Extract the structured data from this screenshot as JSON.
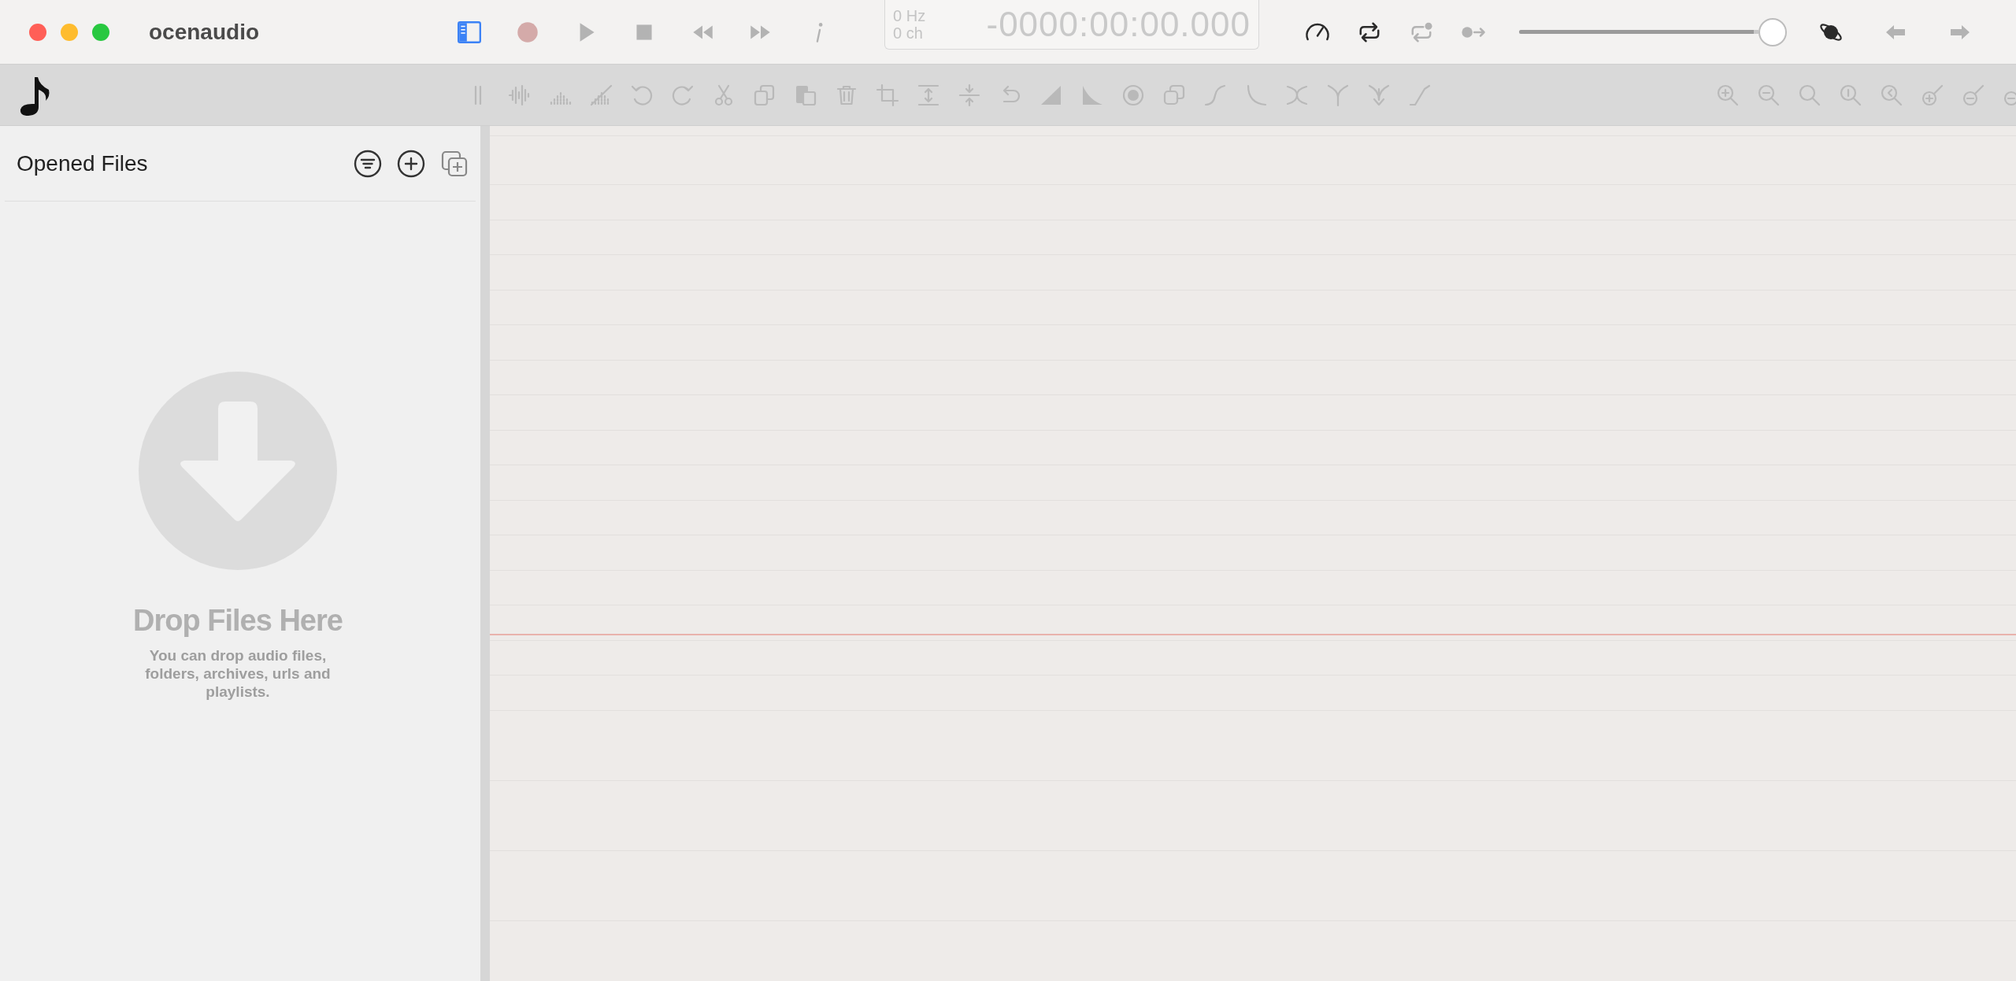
{
  "window": {
    "title": "ocenaudio"
  },
  "transport": [
    {
      "kind": "sidebar",
      "disabled": false
    },
    {
      "kind": "record",
      "disabled": true
    },
    {
      "kind": "play",
      "disabled": true
    },
    {
      "kind": "stop",
      "disabled": true
    },
    {
      "kind": "rewind",
      "disabled": true
    },
    {
      "kind": "forward",
      "disabled": true
    },
    {
      "kind": "info",
      "disabled": true
    }
  ],
  "display": {
    "rate": "0 Hz",
    "channels": "0 ch",
    "time": "-0000:00:00.000"
  },
  "playback_tools": [
    {
      "kind": "speed",
      "disabled": false
    },
    {
      "kind": "loop",
      "disabled": false
    },
    {
      "kind": "loop-selection",
      "disabled": true
    },
    {
      "kind": "follow",
      "disabled": true
    }
  ],
  "volume": {
    "level": 0.98
  },
  "nav_tools": [
    {
      "kind": "planet",
      "disabled": false
    },
    {
      "kind": "back",
      "disabled": true
    },
    {
      "kind": "next",
      "disabled": true
    }
  ],
  "edit_toolbar": [
    {
      "kind": "channels",
      "disabled": true
    },
    {
      "kind": "waveform",
      "disabled": true
    },
    {
      "kind": "spectrum",
      "disabled": true
    },
    {
      "kind": "spectrum-off",
      "disabled": true
    },
    {
      "kind": "undo",
      "disabled": true
    },
    {
      "kind": "redo",
      "disabled": true
    },
    {
      "kind": "cut",
      "disabled": true
    },
    {
      "kind": "copy",
      "disabled": true
    },
    {
      "kind": "paste",
      "disabled": true
    },
    {
      "kind": "delete",
      "disabled": true
    },
    {
      "kind": "crop",
      "disabled": true
    },
    {
      "kind": "expand",
      "disabled": true
    },
    {
      "kind": "contract",
      "disabled": true
    },
    {
      "kind": "reverse",
      "disabled": true
    },
    {
      "kind": "fade-in",
      "disabled": true
    },
    {
      "kind": "fade-out",
      "disabled": true
    },
    {
      "kind": "normalize",
      "disabled": true
    },
    {
      "kind": "duplicate",
      "disabled": true
    },
    {
      "kind": "curve-up",
      "disabled": true
    },
    {
      "kind": "curve-down",
      "disabled": true
    },
    {
      "kind": "cross",
      "disabled": true
    },
    {
      "kind": "split",
      "disabled": true
    },
    {
      "kind": "merge",
      "disabled": true
    },
    {
      "kind": "ramp",
      "disabled": true
    }
  ],
  "zoom_toolbar": [
    {
      "kind": "zoom-in",
      "disabled": true
    },
    {
      "kind": "zoom-out",
      "disabled": true
    },
    {
      "kind": "zoom-fit",
      "disabled": true
    },
    {
      "kind": "zoom-one",
      "disabled": true
    },
    {
      "kind": "zoom-back",
      "disabled": true
    },
    {
      "kind": "v-zoom-in",
      "disabled": true
    },
    {
      "kind": "v-zoom-out",
      "disabled": true
    },
    {
      "kind": "v-zoom-reset",
      "disabled": true
    }
  ],
  "sidebar": {
    "title": "Opened Files",
    "drop_title": "Drop Files Here",
    "drop_hint": "You can drop audio files, folders, archives, urls and playlists."
  }
}
